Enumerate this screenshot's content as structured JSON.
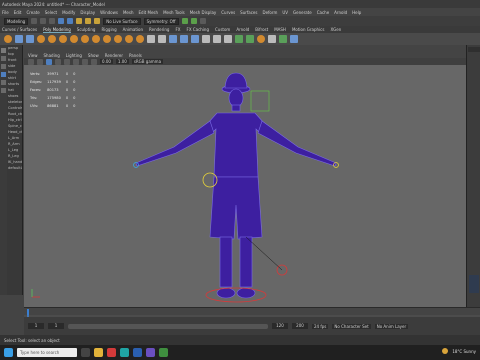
{
  "title": "Autodesk Maya 2024: untitled*  ---  Character_Model",
  "menubar": [
    "File",
    "Edit",
    "Create",
    "Select",
    "Modify",
    "Display",
    "Windows",
    "Mesh",
    "Edit Mesh",
    "Mesh Tools",
    "Mesh Display",
    "Curves",
    "Surfaces",
    "Deform",
    "UV",
    "Generate",
    "Cache",
    "Arnold",
    "Help"
  ],
  "mode": "Modeling",
  "status_field": "No Live Surface",
  "symmetry": "Symmetry: Off",
  "shelf_tabs": [
    "Curves / Surfaces",
    "Poly Modeling",
    "Sculpting",
    "Rigging",
    "Animation",
    "Rendering",
    "FX",
    "FX Caching",
    "Custom",
    "Arnold",
    "Bifrost",
    "MASH",
    "Motion Graphics",
    "XGen"
  ],
  "shelf_active": "Poly Modeling",
  "panel_menu": [
    "View",
    "Shading",
    "Lighting",
    "Show",
    "Renderer",
    "Panels"
  ],
  "panel_fields": [
    "0.00",
    "1.00",
    "sRGB gamma"
  ],
  "hud": [
    {
      "label": "Verts:",
      "a": "39971",
      "b": "0",
      "c": "0"
    },
    {
      "label": "Edges:",
      "a": "117939",
      "b": "0",
      "c": "0"
    },
    {
      "label": "Faces:",
      "a": "80173",
      "b": "0",
      "c": "0"
    },
    {
      "label": "Tris:",
      "a": "175980",
      "b": "0",
      "c": "0"
    },
    {
      "label": "UVs:",
      "a": "86881",
      "b": "0",
      "c": "0"
    }
  ],
  "outliner_items": [
    "persp",
    "top",
    "front",
    "side",
    "body",
    "shirt",
    "shorts",
    "hat",
    "shoes",
    "skeleton",
    "Controls",
    "Root_ctrl",
    "Hip_ctrl",
    "Spine_ctrl",
    "Head_ctrl",
    "L_Arm",
    "R_Arm",
    "L_Leg",
    "R_Leg",
    "IK_handles",
    "defaultLight"
  ],
  "camera_label": "persp",
  "range": {
    "start": "1",
    "end": "120",
    "anim_end": "200",
    "fps": "24 fps",
    "current": "1"
  },
  "char_set": "No Character Set",
  "anim_layer": "No Anim Layer",
  "helpline": "Select Tool: select an object",
  "search_placeholder": "Type here to search",
  "weather": "18°C  Sunny",
  "colors": {
    "viewport": "#676767",
    "wire": "#3d1fa0",
    "accent": "#4f7fbf"
  }
}
